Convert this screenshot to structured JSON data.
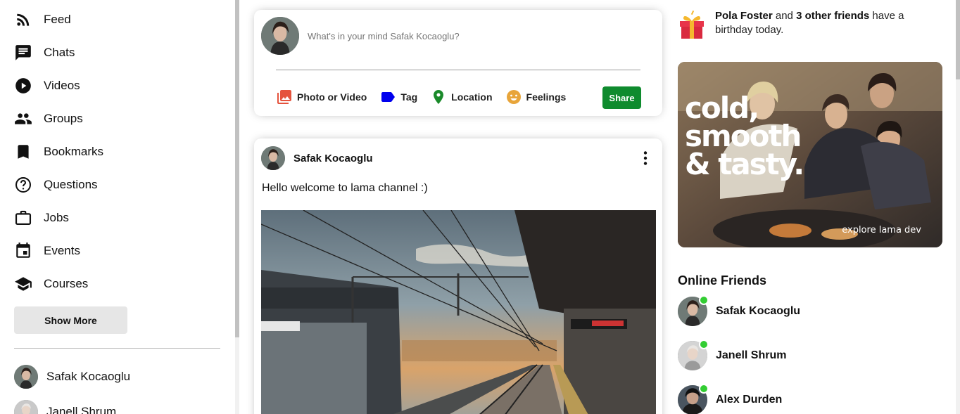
{
  "sidebar": {
    "items": [
      {
        "label": "Feed",
        "icon": "rss-feed-icon"
      },
      {
        "label": "Chats",
        "icon": "chat-icon"
      },
      {
        "label": "Videos",
        "icon": "play-circle-icon"
      },
      {
        "label": "Groups",
        "icon": "group-icon"
      },
      {
        "label": "Bookmarks",
        "icon": "bookmark-icon"
      },
      {
        "label": "Questions",
        "icon": "help-outline-icon"
      },
      {
        "label": "Jobs",
        "icon": "work-outline-icon"
      },
      {
        "label": "Events",
        "icon": "event-icon"
      },
      {
        "label": "Courses",
        "icon": "school-icon"
      }
    ],
    "show_more_label": "Show More",
    "friends": [
      {
        "name": "Safak Kocaoglu"
      },
      {
        "name": "Janell Shrum"
      }
    ]
  },
  "share": {
    "placeholder": "What's in your mind Safak Kocaoglu?",
    "options": [
      {
        "label": "Photo or Video",
        "icon": "photo-library-icon",
        "color": "#e5533d"
      },
      {
        "label": "Tag",
        "icon": "label-icon",
        "color": "#0000ee"
      },
      {
        "label": "Location",
        "icon": "room-icon",
        "color": "#1a8a2a"
      },
      {
        "label": "Feelings",
        "icon": "emoji-icon",
        "color": "#e8a53a"
      }
    ],
    "share_label": "Share",
    "share_color": "#0f8b2e"
  },
  "post": {
    "author": "Safak Kocaoglu",
    "text": "Hello welcome to lama channel :)",
    "more_icon": "more-vert-icon",
    "image_description_icon": "train-station-photo"
  },
  "rightbar": {
    "birthday": {
      "name": "Pola Foster",
      "middle": " and ",
      "friends": "3 other friends",
      "suffix": " have a birthday today."
    },
    "ad": {
      "headline_1": "cold,",
      "headline_2": "smooth",
      "headline_3": "& tasty.",
      "subline": "explore lama dev"
    },
    "online_title": "Online Friends",
    "online_friends": [
      {
        "name": "Safak Kocaoglu"
      },
      {
        "name": "Janell Shrum"
      },
      {
        "name": "Alex Durden"
      }
    ]
  }
}
